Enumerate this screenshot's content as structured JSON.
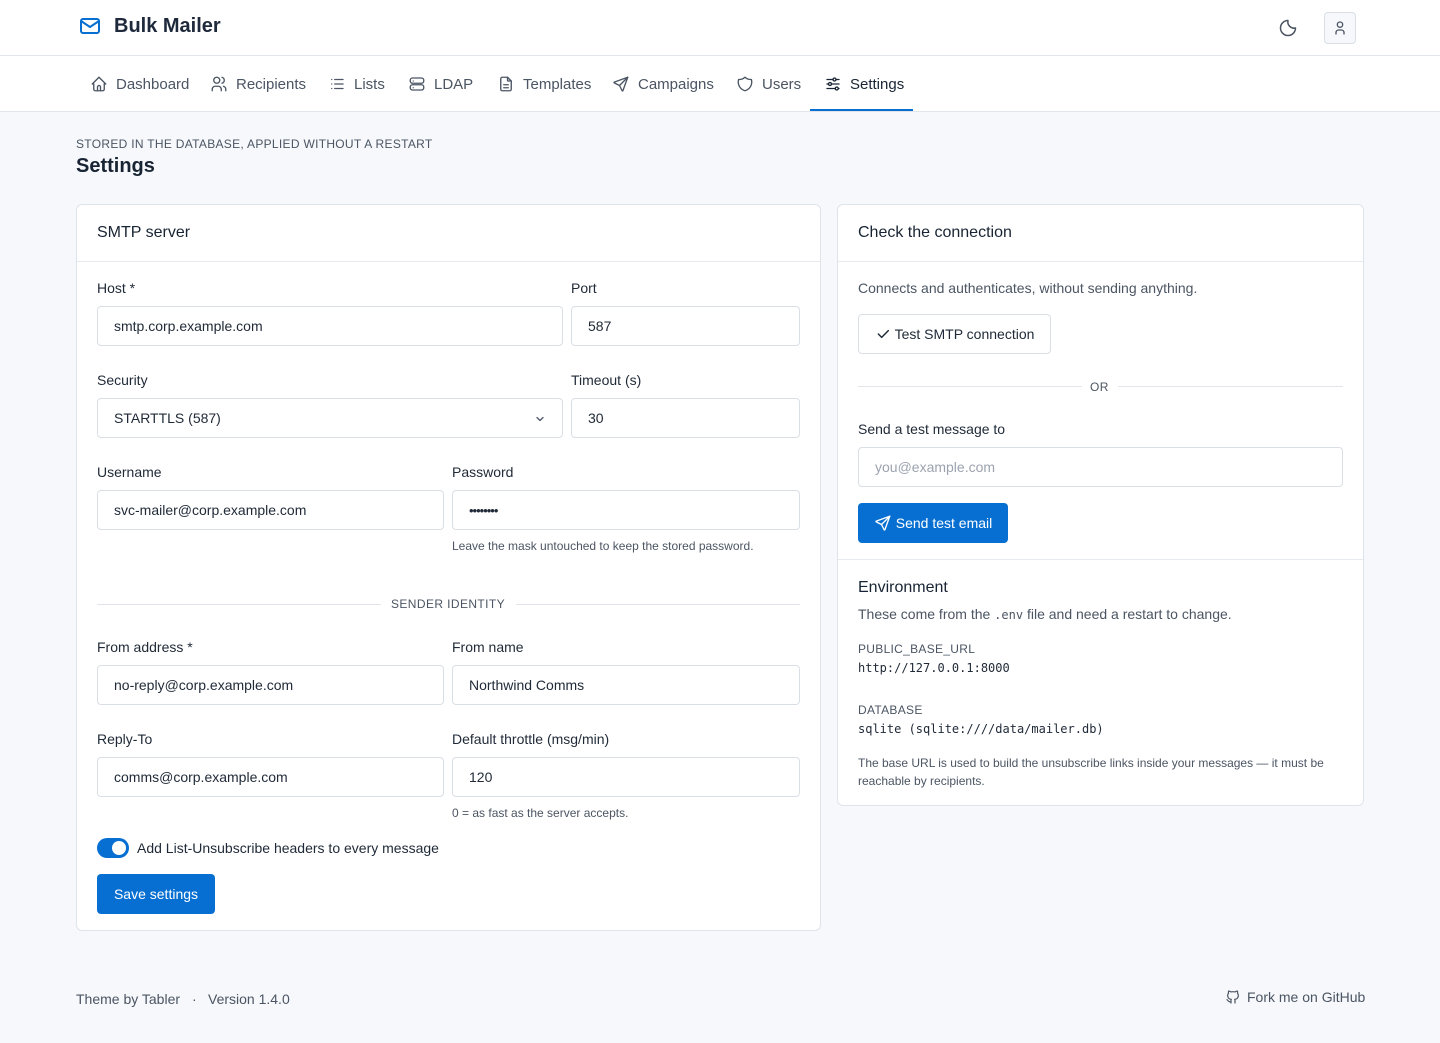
{
  "app": {
    "title": "Bulk Mailer"
  },
  "nav": {
    "items": [
      {
        "label": "Dashboard",
        "icon": "home-icon"
      },
      {
        "label": "Recipients",
        "icon": "users-icon"
      },
      {
        "label": "Lists",
        "icon": "list-icon"
      },
      {
        "label": "LDAP",
        "icon": "server-icon"
      },
      {
        "label": "Templates",
        "icon": "file-icon"
      },
      {
        "label": "Campaigns",
        "icon": "send-icon"
      },
      {
        "label": "Users",
        "icon": "shield-icon"
      },
      {
        "label": "Settings",
        "icon": "sliders-icon",
        "active": true
      }
    ]
  },
  "page": {
    "pretitle": "STORED IN THE DATABASE, APPLIED WITHOUT A RESTART",
    "title": "Settings"
  },
  "smtp": {
    "header": "SMTP server",
    "host_label": "Host *",
    "host_value": "smtp.corp.example.com",
    "port_label": "Port",
    "port_value": "587",
    "security_label": "Security",
    "security_value": "STARTTLS (587)",
    "timeout_label": "Timeout (s)",
    "timeout_value": "30",
    "username_label": "Username",
    "username_value": "svc-mailer@corp.example.com",
    "password_label": "Password",
    "password_value": "••••••••",
    "password_hint": "Leave the mask untouched to keep the stored password.",
    "sender_divider": "SENDER IDENTITY",
    "from_address_label": "From address *",
    "from_address_value": "no-reply@corp.example.com",
    "from_name_label": "From name",
    "from_name_value": "Northwind Comms",
    "reply_to_label": "Reply-To",
    "reply_to_value": "comms@corp.example.com",
    "throttle_label": "Default throttle (msg/min)",
    "throttle_value": "120",
    "throttle_hint": "0 = as fast as the server accepts.",
    "unsubscribe_label": "Add List-Unsubscribe headers to every message",
    "unsubscribe_enabled": true,
    "save_label": "Save settings"
  },
  "check": {
    "header": "Check the connection",
    "description": "Connects and authenticates, without sending anything.",
    "test_button": "Test SMTP connection",
    "or_label": "OR",
    "send_to_label": "Send a test message to",
    "send_to_placeholder": "you@example.com",
    "send_button": "Send test email"
  },
  "environment": {
    "title": "Environment",
    "desc_before": "These come from the ",
    "desc_code": ".env",
    "desc_after": " file and need a restart to change.",
    "vars": [
      {
        "name": "PUBLIC_BASE_URL",
        "value": "http://127.0.0.1:8000"
      },
      {
        "name": "DATABASE",
        "value": "sqlite (sqlite:////data/mailer.db)"
      }
    ],
    "note": "The base URL is used to build the unsubscribe links inside your messages — it must be reachable by recipients."
  },
  "footer": {
    "theme": "Theme by Tabler",
    "separator": "·",
    "version": "Version 1.4.0",
    "github": "Fork me on GitHub"
  },
  "colors": {
    "accent": "#066fd1",
    "background": "#f6f8fb"
  }
}
